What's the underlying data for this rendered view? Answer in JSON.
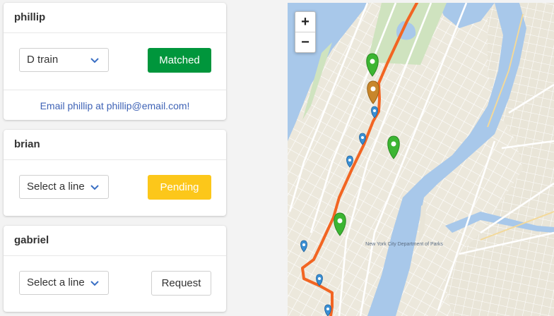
{
  "users": [
    {
      "name": "phillip",
      "line": "D train",
      "status": "Matched",
      "email_link": "Email phillip at phillip@email.com!"
    },
    {
      "name": "brian",
      "line": "Select a line",
      "status": "Pending"
    },
    {
      "name": "gabriel",
      "line": "Select a line",
      "status": "Request"
    }
  ],
  "map": {
    "zoom_in": "+",
    "zoom_out": "−",
    "route_color": "#f26522",
    "marker_colors": {
      "matched": "#3cb532",
      "selected": "#c8862b",
      "stop": "#3a8fd3"
    },
    "place_label": "New York City Department of Parks"
  },
  "colors": {
    "matched": "#00963c",
    "pending": "#fcc71a",
    "link": "#3f63b6"
  }
}
